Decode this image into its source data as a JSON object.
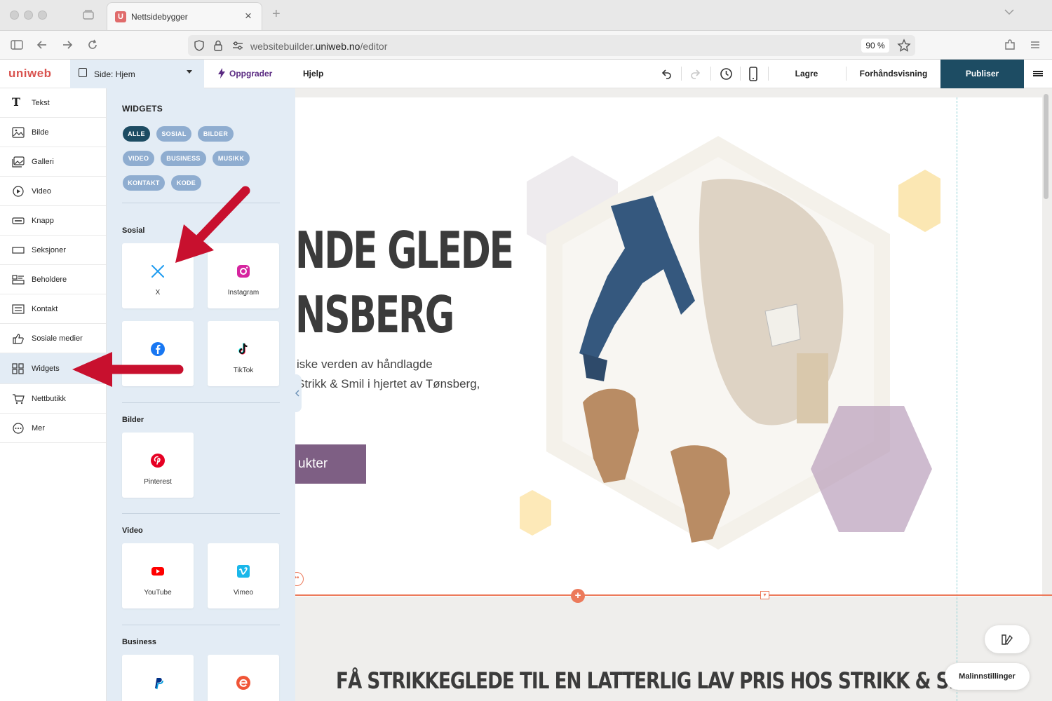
{
  "browser": {
    "tab_title": "Nettsidebygger",
    "tab_favicon_letter": "U",
    "url_prefix": "websitebuilder.",
    "url_domain": "uniweb.no",
    "url_path": "/editor",
    "zoom": "90 %"
  },
  "toolbar": {
    "logo": "uniweb",
    "page_selector": "Side: Hjem",
    "upgrade": "Oppgrader",
    "help": "Hjelp",
    "save": "Lagre",
    "preview": "Forhåndsvisning",
    "publish": "Publiser"
  },
  "sidebar": {
    "items": [
      {
        "label": "Tekst",
        "icon": "text-icon"
      },
      {
        "label": "Bilde",
        "icon": "image-icon"
      },
      {
        "label": "Galleri",
        "icon": "gallery-icon"
      },
      {
        "label": "Video",
        "icon": "video-icon"
      },
      {
        "label": "Knapp",
        "icon": "button-icon"
      },
      {
        "label": "Seksjoner",
        "icon": "sections-icon"
      },
      {
        "label": "Beholdere",
        "icon": "containers-icon"
      },
      {
        "label": "Kontakt",
        "icon": "contact-icon"
      },
      {
        "label": "Sosiale medier",
        "icon": "thumbs-up-icon"
      },
      {
        "label": "Widgets",
        "icon": "widgets-icon"
      },
      {
        "label": "Nettbutikk",
        "icon": "cart-icon"
      },
      {
        "label": "Mer",
        "icon": "more-icon"
      }
    ],
    "active": "Widgets"
  },
  "widgets_panel": {
    "title": "WIDGETS",
    "filters": [
      "ALLE",
      "SOSIAL",
      "BILDER",
      "VIDEO",
      "BUSINESS",
      "MUSIKK",
      "KONTAKT",
      "KODE"
    ],
    "active_filter": "ALLE",
    "sections": {
      "social": {
        "title": "Sosial",
        "widgets": [
          "X",
          "Instagram",
          "",
          "TikTok"
        ]
      },
      "images": {
        "title": "Bilder",
        "widgets": [
          "Pinterest"
        ]
      },
      "video": {
        "title": "Video",
        "widgets": [
          "YouTube",
          "Vimeo"
        ]
      },
      "business": {
        "title": "Business",
        "widgets": [
          "",
          ""
        ]
      }
    }
  },
  "canvas": {
    "headline_line1": "NDE GLEDE",
    "headline_line2": "NSBERG",
    "body_line1": "iske verden av håndlagde",
    "body_line2": "Strikk & Smil i hjertet av Tønsberg,",
    "cta": "ukter",
    "bottom_heading": "FÅ STRIKKEGLEDE TIL EN LATTERLIG LAV PRIS HOS STRIKK & SMIL!",
    "template_settings": "Malinnstillinger"
  },
  "colors": {
    "accent_dark": "#1d4c63",
    "panel_bg": "#e3ecf5",
    "chip": "#8fadd0",
    "cta": "#7e5f84",
    "section_line": "#ec7a5b",
    "annotation_arrow": "#d0021b"
  }
}
